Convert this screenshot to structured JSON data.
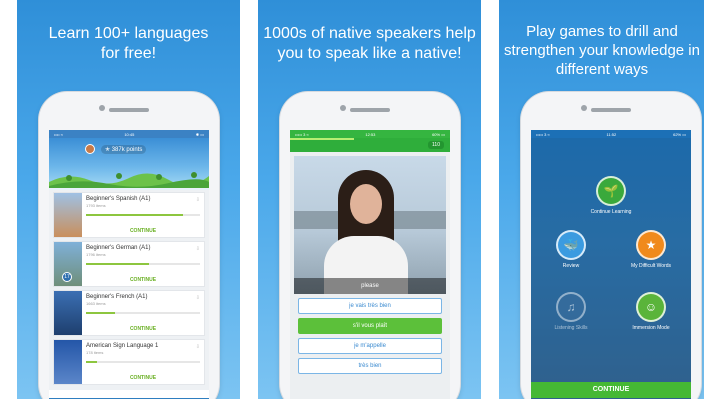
{
  "panels": [
    {
      "headline": "Learn 100+ languages\nfor free!"
    },
    {
      "headline": "1000s of native speakers help\nyou to speak like a native!"
    },
    {
      "headline": "Play games to drill and\nstrengthen your knowledge in\ndifferent ways"
    }
  ],
  "screen1": {
    "status_left": "•••• ≈",
    "status_time": "10:45",
    "status_right": "✱ ▭",
    "points": "✭ 387k points",
    "courses": [
      {
        "title": "Beginner's Spanish (A1)",
        "items": "1793 items",
        "button": "CONTINUE",
        "level": "",
        "progress": 0.85,
        "thumb_color": "#c98f5c"
      },
      {
        "title": "Beginner's German (A1)",
        "items": "1796 items",
        "button": "CONTINUE",
        "level": "17",
        "progress": 0.55,
        "thumb_color": "#6f8f7a"
      },
      {
        "title": "Beginner's French (A1)",
        "items": "1663 items",
        "button": "CONTINUE",
        "level": "",
        "progress": 0.25,
        "thumb_color": "#3b6fb3"
      },
      {
        "title": "American Sign Language 1",
        "items": "178 items",
        "button": "CONTINUE",
        "level": "",
        "progress": 0.1,
        "thumb_color": "#2456a8"
      }
    ],
    "tabs": [
      "🎓",
      "⌕",
      "🏆",
      "👤"
    ]
  },
  "screen2": {
    "status_left": "••••• 3  ≈",
    "status_time": "12:53",
    "status_right": "60% ▭",
    "count": "110",
    "caption": "please",
    "options": [
      "je vais très bien",
      "s'il vous plaît",
      "je m'appelle",
      "très bien"
    ],
    "selected_index": 1
  },
  "screen3": {
    "status_left": "••••• 3  ≈",
    "status_time": "11:52",
    "status_right": "62% ▭",
    "games": [
      {
        "label": "Continue Learning",
        "icon": "🌱",
        "color": "#3aa93c"
      },
      {
        "label": "Review",
        "icon": "🐳",
        "color": "#3b9be0"
      },
      {
        "label": "My Difficult Words",
        "icon": "★",
        "color": "#f08a1c"
      },
      {
        "label": "Listening Skills",
        "icon": "♫",
        "color": "#3a6e9e"
      },
      {
        "label": "Immersion Mode",
        "icon": "☺",
        "color": "#5ab43a"
      }
    ],
    "continue": "CONTINUE"
  }
}
